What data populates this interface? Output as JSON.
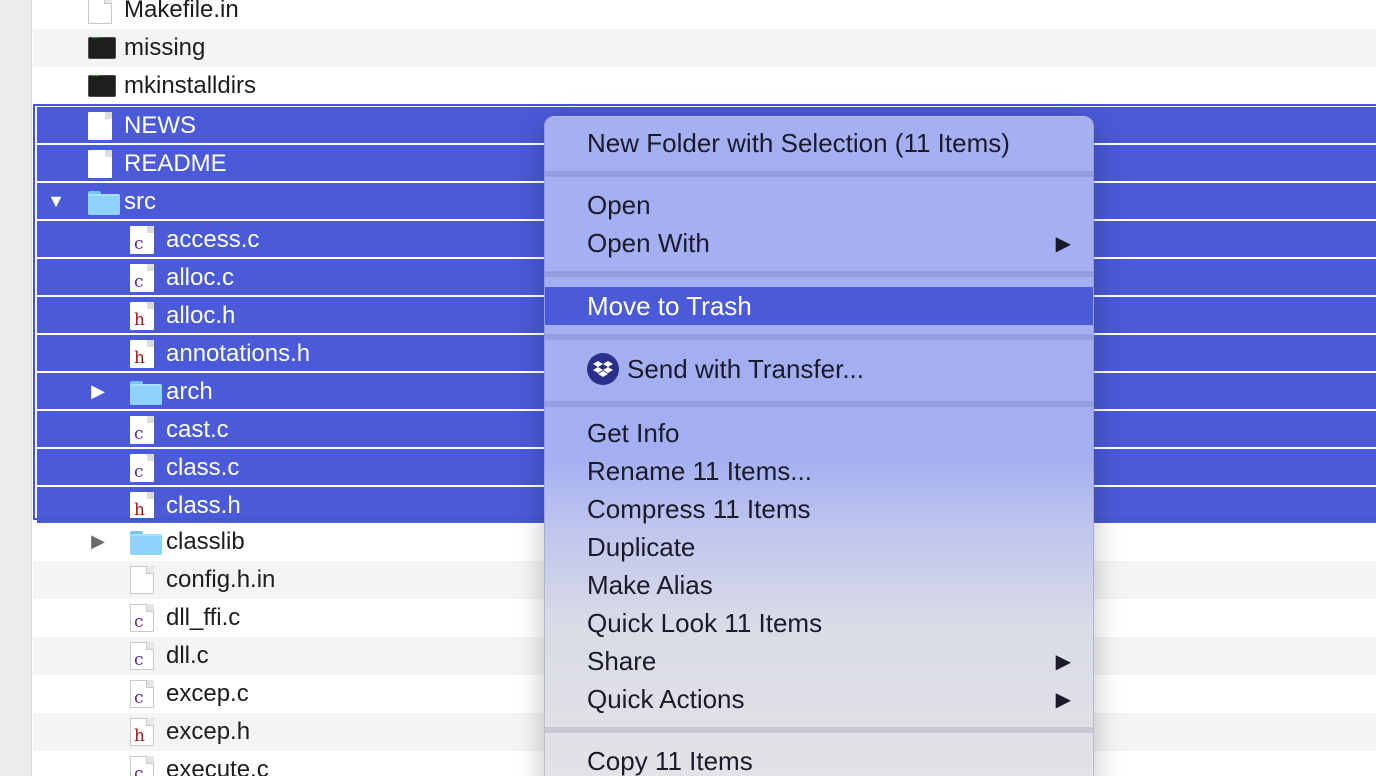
{
  "files": [
    {
      "name": "Makefile.in",
      "icon": "doc",
      "level": 1,
      "stripe": false,
      "selected": false
    },
    {
      "name": "missing",
      "icon": "term",
      "level": 1,
      "stripe": true,
      "selected": false
    },
    {
      "name": "mkinstalldirs",
      "icon": "term",
      "level": 1,
      "stripe": false,
      "selected": false
    },
    {
      "name": "NEWS",
      "icon": "doc",
      "level": 1,
      "stripe": false,
      "selected": true
    },
    {
      "name": "README",
      "icon": "doc",
      "level": 1,
      "stripe": false,
      "selected": true
    },
    {
      "name": "src",
      "icon": "folder",
      "level": 1,
      "stripe": false,
      "selected": true,
      "disclosure": "open"
    },
    {
      "name": "access.c",
      "icon": "c",
      "level": 2,
      "stripe": false,
      "selected": true
    },
    {
      "name": "alloc.c",
      "icon": "c",
      "level": 2,
      "stripe": false,
      "selected": true
    },
    {
      "name": "alloc.h",
      "icon": "h",
      "level": 2,
      "stripe": false,
      "selected": true
    },
    {
      "name": "annotations.h",
      "icon": "h",
      "level": 2,
      "stripe": false,
      "selected": true
    },
    {
      "name": "arch",
      "icon": "folder",
      "level": 2,
      "stripe": false,
      "selected": true,
      "disclosure": "closed"
    },
    {
      "name": "cast.c",
      "icon": "c",
      "level": 2,
      "stripe": false,
      "selected": true
    },
    {
      "name": "class.c",
      "icon": "c",
      "level": 2,
      "stripe": false,
      "selected": true
    },
    {
      "name": "class.h",
      "icon": "h",
      "level": 2,
      "stripe": false,
      "selected": true
    },
    {
      "name": "classlib",
      "icon": "folder",
      "level": 2,
      "stripe": false,
      "selected": false,
      "disclosure": "closed"
    },
    {
      "name": "config.h.in",
      "icon": "doc",
      "level": 2,
      "stripe": true,
      "selected": false
    },
    {
      "name": "dll_ffi.c",
      "icon": "c",
      "level": 2,
      "stripe": false,
      "selected": false
    },
    {
      "name": "dll.c",
      "icon": "c",
      "level": 2,
      "stripe": true,
      "selected": false
    },
    {
      "name": "excep.c",
      "icon": "c",
      "level": 2,
      "stripe": false,
      "selected": false
    },
    {
      "name": "excep.h",
      "icon": "h",
      "level": 2,
      "stripe": true,
      "selected": false
    },
    {
      "name": "execute.c",
      "icon": "c",
      "level": 2,
      "stripe": false,
      "selected": false
    }
  ],
  "icon_letters": {
    "c": "c",
    "h": "h"
  },
  "context_menu": {
    "new_folder": "New Folder with Selection (11 Items)",
    "open": "Open",
    "open_with": "Open With",
    "move_to_trash": "Move to Trash",
    "send_with_transfer": "Send with Transfer...",
    "get_info": "Get Info",
    "rename": "Rename 11 Items...",
    "compress": "Compress 11 Items",
    "duplicate": "Duplicate",
    "make_alias": "Make Alias",
    "quick_look": "Quick Look 11 Items",
    "share": "Share",
    "quick_actions": "Quick Actions",
    "copy": "Copy 11 Items",
    "submenu_arrow": "▶"
  },
  "colors": {
    "selection": "#4a5ad8",
    "menu_highlight": "#4a5ad8",
    "folder": "#8dd3fb"
  }
}
